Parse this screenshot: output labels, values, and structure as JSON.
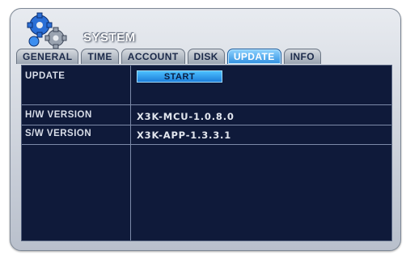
{
  "window": {
    "title": "SYSTEM"
  },
  "tabs": [
    {
      "label": "GENERAL"
    },
    {
      "label": "TIME"
    },
    {
      "label": "ACCOUNT"
    },
    {
      "label": "DISK"
    },
    {
      "label": "UPDATE"
    },
    {
      "label": "INFO"
    }
  ],
  "active_tab": "UPDATE",
  "rows": {
    "update": {
      "label": "UPDATE",
      "button": "START"
    },
    "hw": {
      "label": "H/W VERSION",
      "value": "X3K-MCU-1.0.8.0"
    },
    "sw": {
      "label": "S/W VERSION",
      "value": "X3K-APP-1.3.3.1"
    }
  },
  "icons": {
    "header": "gears-icon"
  },
  "colors": {
    "panel_bg": "#0f1a3a",
    "active_tab": "#2f8fe0",
    "button": "#1d7fd9"
  }
}
